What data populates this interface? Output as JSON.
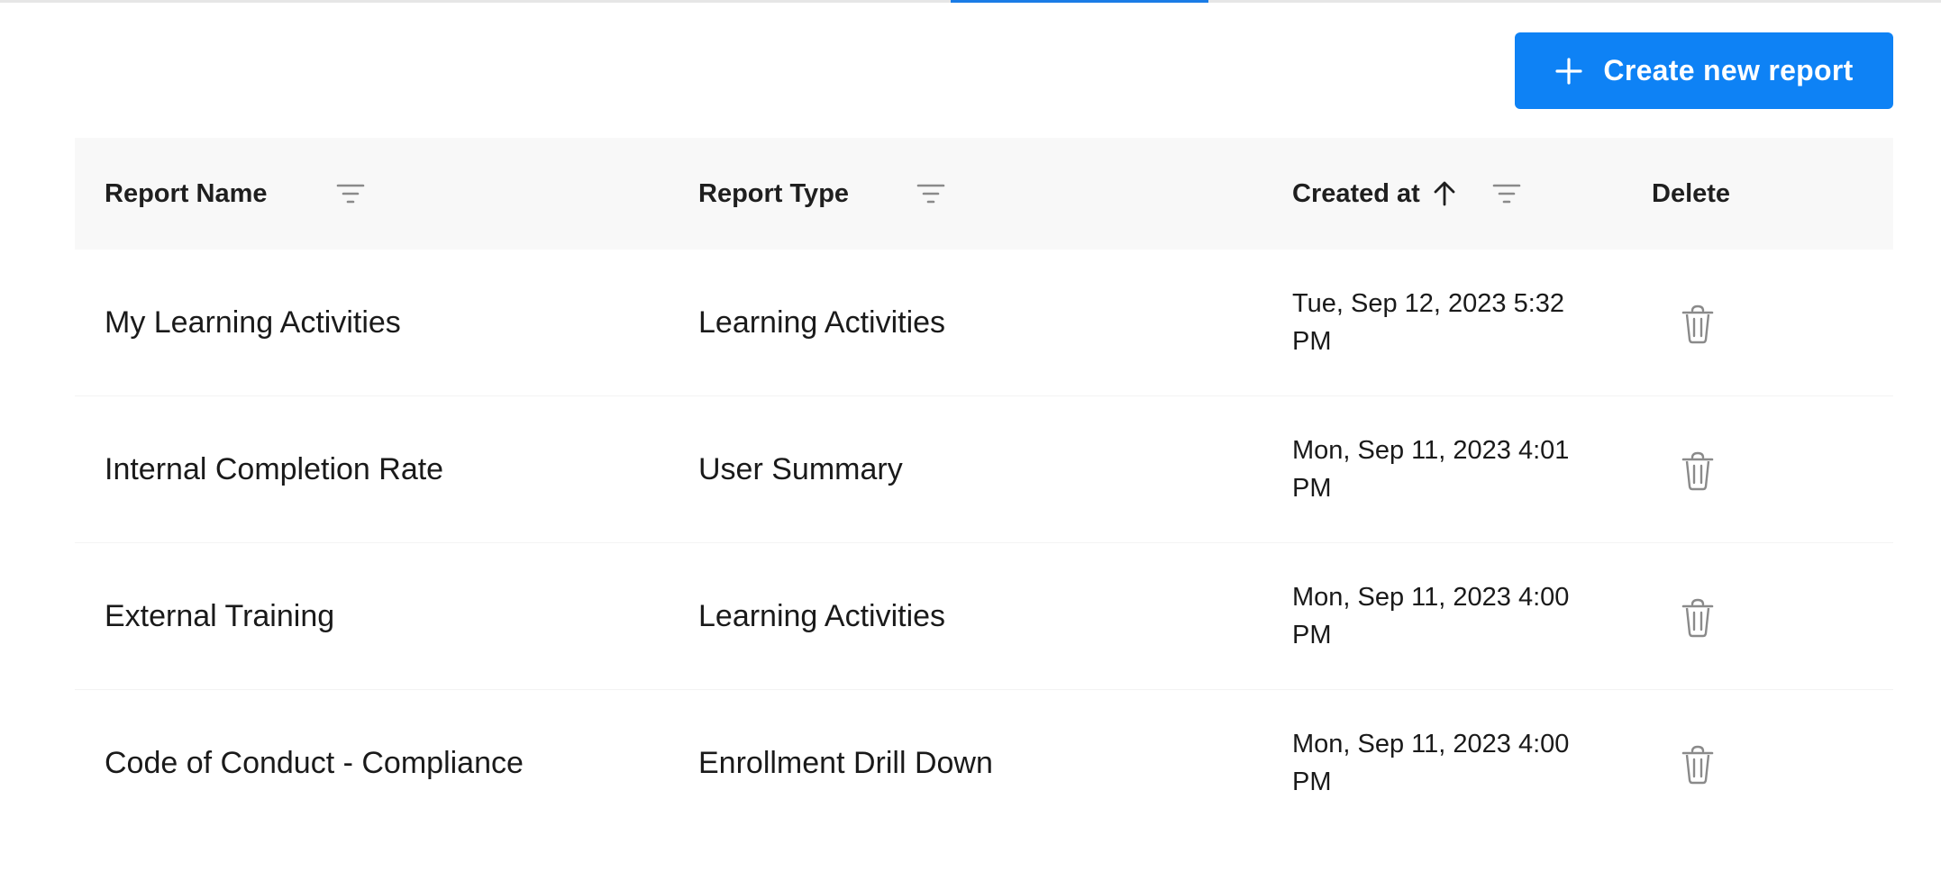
{
  "toolbar": {
    "create_label": "Create new report"
  },
  "table": {
    "columns": {
      "name": "Report Name",
      "type": "Report Type",
      "created": "Created at",
      "delete": "Delete"
    },
    "sort": {
      "column": "created",
      "direction": "ascending"
    },
    "rows": [
      {
        "name": "My Learning Activities",
        "type": "Learning Activities",
        "created": "Tue, Sep 12, 2023 5:32 PM"
      },
      {
        "name": "Internal Completion Rate",
        "type": "User Summary",
        "created": "Mon, Sep 11, 2023 4:01 PM"
      },
      {
        "name": "External Training",
        "type": "Learning Activities",
        "created": "Mon, Sep 11, 2023 4:00 PM"
      },
      {
        "name": "Code of Conduct - Compliance",
        "type": "Enrollment Drill Down",
        "created": "Mon, Sep 11, 2023 4:00 PM"
      }
    ]
  },
  "icons": {
    "plus": "plus-icon",
    "filter": "filter-icon",
    "sort": "arrow-up-icon",
    "delete": "trash-icon"
  },
  "colors": {
    "accent": "#0e82f5",
    "header_bg": "#f8f8f8",
    "icon_gray": "#8a8a8a"
  }
}
